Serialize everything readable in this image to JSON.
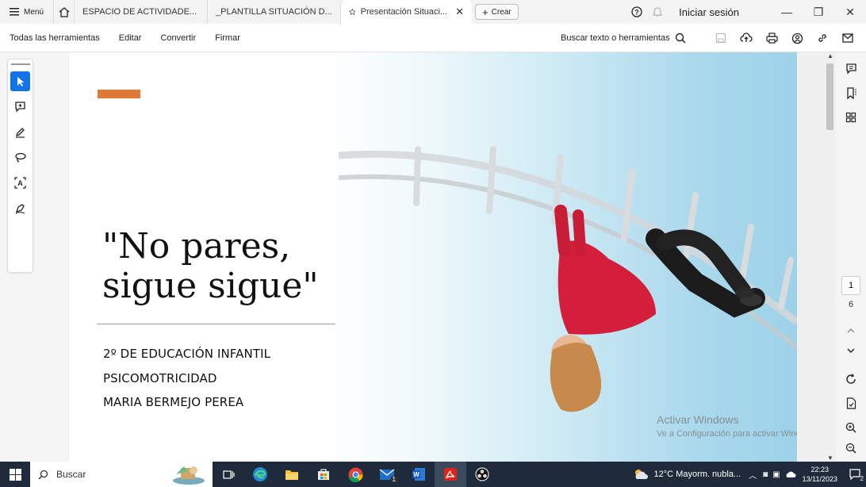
{
  "titlebar": {
    "menu_label": "Menú",
    "tabs": [
      {
        "label": "ESPACIO DE ACTIVIDADE..."
      },
      {
        "label": "_PLANTILLA SITUACIÓN D..."
      },
      {
        "label": "Presentación Situaci..."
      }
    ],
    "create_label": "Crear",
    "signin_label": "Iniciar sesión"
  },
  "toolbar": {
    "items": [
      "Todas las herramientas",
      "Editar",
      "Convertir",
      "Firmar"
    ],
    "search_label": "Buscar texto o herramientas"
  },
  "slide": {
    "title": "\"No pares,\nsigue sigue\"",
    "line1": "2º DE EDUCACIÓN INFANTIL",
    "line2": "PSICOMOTRICIDAD",
    "line3": "MARIA BERMEJO PEREA",
    "accent_color": "#e07a3a"
  },
  "watermark": {
    "title": "Activar Windows",
    "subtitle": "Ve a Configuración para activar Windows."
  },
  "pager": {
    "current": "1",
    "total": "6"
  },
  "taskbar": {
    "search_label": "Buscar",
    "weather": "12°C  Mayorm. nubla...",
    "time": "22:23",
    "date": "13/11/2023",
    "notifications": "2",
    "mail_badge": "1"
  },
  "colors": {
    "accent_blue": "#1473e6",
    "acrobat_red": "#e0241b",
    "taskbar_bg": "#1f2b3a"
  }
}
